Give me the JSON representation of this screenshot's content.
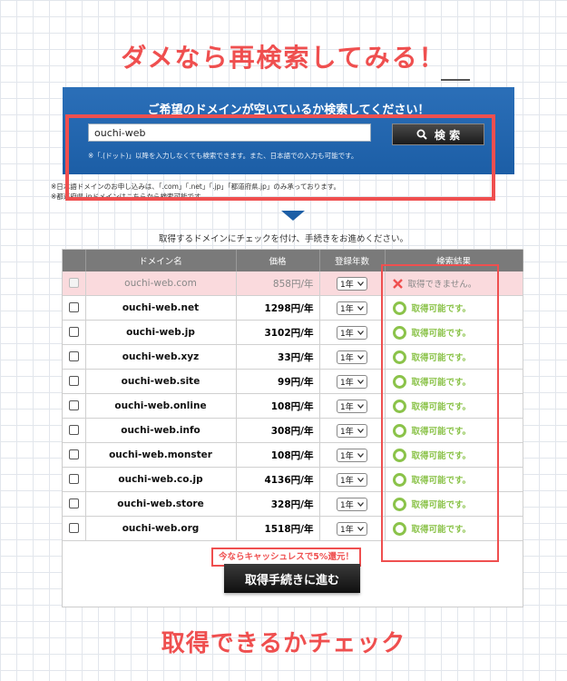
{
  "headings": {
    "top": "ダメなら再検索してみる！",
    "bottom": "取得できるかチェック"
  },
  "search": {
    "title": "ご希望のドメインが空いているか検索してください！",
    "value": "ouchi-web",
    "button_label": "検 索",
    "note": "※「.(ドット)」以降を入力しなくても検索できます。また、日本語での入力も可能です。",
    "info_lines": [
      "※日本語ドメインのお申し込みは、「.com」「.net」「.jp」「都道府県.jp」のみ承っております。",
      "※都道府県.jpドメインはこちらから検索可能です"
    ]
  },
  "instruction": "取得するドメインにチェックを付け、手続きをお進めください。",
  "table": {
    "headers": [
      "",
      "ドメイン名",
      "価格",
      "登録年数",
      "検索結果"
    ],
    "rows": [
      {
        "domain": "ouchi-web.com",
        "price": "858円/年",
        "years": "1年",
        "result": "取得できません。",
        "available": false
      },
      {
        "domain": "ouchi-web.net",
        "price": "1298円/年",
        "years": "1年",
        "result": "取得可能です。",
        "available": true
      },
      {
        "domain": "ouchi-web.jp",
        "price": "3102円/年",
        "years": "1年",
        "result": "取得可能です。",
        "available": true
      },
      {
        "domain": "ouchi-web.xyz",
        "price": "33円/年",
        "years": "1年",
        "result": "取得可能です。",
        "available": true
      },
      {
        "domain": "ouchi-web.site",
        "price": "99円/年",
        "years": "1年",
        "result": "取得可能です。",
        "available": true
      },
      {
        "domain": "ouchi-web.online",
        "price": "108円/年",
        "years": "1年",
        "result": "取得可能です。",
        "available": true
      },
      {
        "domain": "ouchi-web.info",
        "price": "308円/年",
        "years": "1年",
        "result": "取得可能です。",
        "available": true
      },
      {
        "domain": "ouchi-web.monster",
        "price": "108円/年",
        "years": "1年",
        "result": "取得可能です。",
        "available": true
      },
      {
        "domain": "ouchi-web.co.jp",
        "price": "4136円/年",
        "years": "1年",
        "result": "取得可能です。",
        "available": true
      },
      {
        "domain": "ouchi-web.store",
        "price": "328円/年",
        "years": "1年",
        "result": "取得可能です。",
        "available": true
      },
      {
        "domain": "ouchi-web.org",
        "price": "1518円/年",
        "years": "1年",
        "result": "取得可能です。",
        "available": true
      }
    ]
  },
  "promo": "今ならキャッシュレスで5%還元！",
  "proceed_label": "取得手続きに進む",
  "colors": {
    "accent_red": "#ef4f4f",
    "panel_blue": "#1c5ea6",
    "available_green": "#8bc34a",
    "unavailable_row": "#fadadd"
  }
}
